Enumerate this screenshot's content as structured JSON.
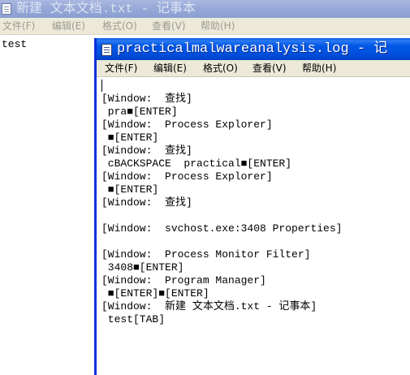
{
  "background_window": {
    "title": "新建 文本文档.txt - 记事本",
    "menu": [
      {
        "label": "文件(F)"
      },
      {
        "label": "编辑(E)"
      },
      {
        "label": "格式(O)"
      },
      {
        "label": "查看(V)"
      },
      {
        "label": "帮助(H)"
      }
    ],
    "content": "test"
  },
  "front_window": {
    "title": "practicalmalwareanalysis.log - 记",
    "menu": [
      {
        "label": "文件(F)"
      },
      {
        "label": "编辑(E)"
      },
      {
        "label": "格式(O)"
      },
      {
        "label": "查看(V)"
      },
      {
        "label": "帮助(H)"
      }
    ],
    "lines": [
      {
        "text": ""
      },
      {
        "text": "[Window:  查找]"
      },
      {
        "text": " pra■[ENTER]"
      },
      {
        "text": "[Window:  Process Explorer]"
      },
      {
        "text": " ■[ENTER]"
      },
      {
        "text": "[Window:  查找]"
      },
      {
        "text": " cBACKSPACE  practical■[ENTER]"
      },
      {
        "text": "[Window:  Process Explorer]"
      },
      {
        "text": " ■[ENTER]"
      },
      {
        "text": "[Window:  查找]"
      },
      {
        "text": ""
      },
      {
        "text": "[Window:  svchost.exe:3408 Properties]"
      },
      {
        "text": ""
      },
      {
        "text": "[Window:  Process Monitor Filter]"
      },
      {
        "text": " 3408■[ENTER]"
      },
      {
        "text": "[Window:  Program Manager]"
      },
      {
        "text": " ■[ENTER]■[ENTER]"
      },
      {
        "text": "[Window:  新建 文本文档.txt - 记事本]"
      },
      {
        "text": " test[TAB]"
      }
    ]
  },
  "colors": {
    "active_title": "#0054e3",
    "inactive_title": "#97a9d8",
    "menu_bg": "#ece9d8",
    "frame_border": "#0831d9"
  }
}
